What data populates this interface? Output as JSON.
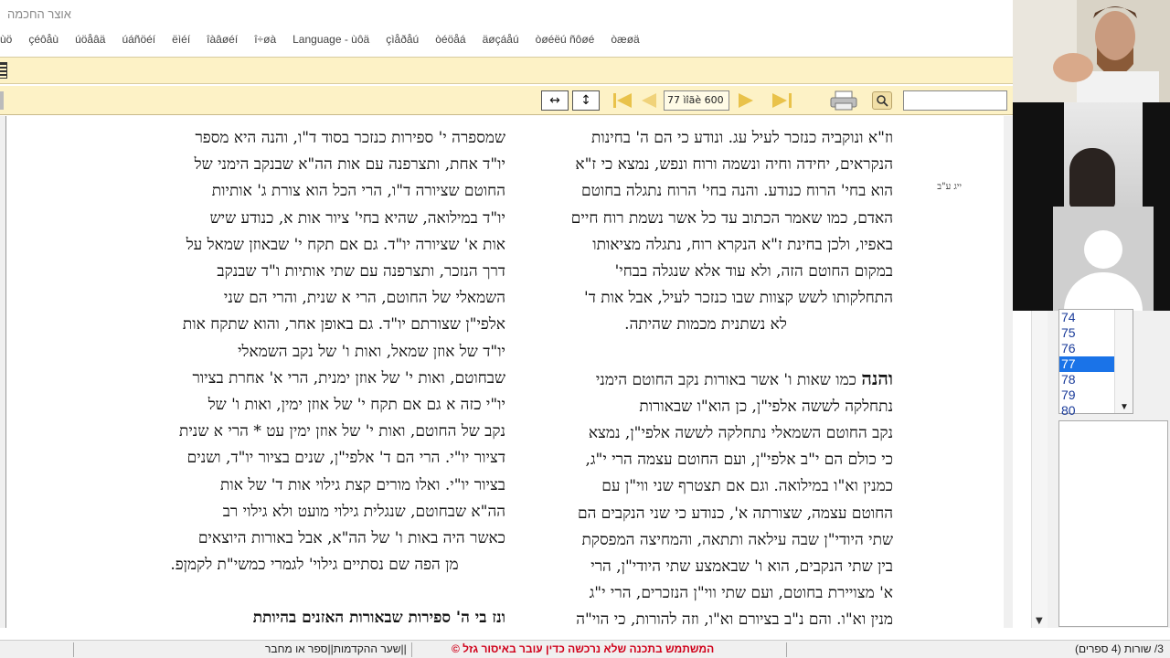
{
  "window": {
    "title": "אוצר החכמה"
  },
  "menu": {
    "items": [
      "ùö",
      "çéôåù",
      "úöåâä",
      "úáñöéí",
      "ëìéí",
      "îàâøéí",
      "î÷øà",
      "Language - ùôä",
      "çìåðåú",
      "òéöåá",
      "äøçáåú",
      "òøéëú ñôøé",
      "òæøä"
    ]
  },
  "toolbar": {
    "page_indicator": "77 ìîãè 600"
  },
  "text": {
    "right_lines": [
      "וז\"א ונוקביה כנזכר לעיל עג. ונודע כי הם ה' בחינות",
      "הנקראים, יחידה וחיה ונשמה ורוח ונפש, נמצא כי ז\"א",
      "הוא בחי' הרוח כנודע. והנה בחי' הרוח נתגלה בחוטם",
      "האדם, כמו שאמר הכתוב עד כל אשר נשמת רוח חיים",
      "באפיו, ולכן בחינת ז\"א הנקרא רוח, נתגלה מציאותו",
      "במקום החוטם הזה, ולא עוד אלא שנגלה בבחי'",
      "התחלקותו לשש קצוות שבו כנזכר לעיל, אבל אות ד'",
      "לא נשתנית מכמות שהיתה."
    ],
    "right_lead": "והנה",
    "right_lines2": [
      "כמו שאות ו' אשר באורות נקב החוטם הימני",
      "נתחלקה לששה אלפי\"ן, כן הוא\"ו שבאורות",
      "נקב החוטם השמאלי נתחלקה לששה אלפי\"ן, נמצא",
      "כי כולם הם י\"ב אלפי\"ן, ועם החוטם עצמה הרי י\"ג,",
      "כמנין וא\"ו במילואה. וגם אם תצטרף שני ווי\"ן עם",
      "החוטם עצמה, שצורתה א', כנודע כי שני הנקבים הם",
      "שתי היודי\"ן שבה עילאה ותתאה, והמחיצה המפסקת",
      "בין שתי הנקבים, הוא ו' שבאמצע שתי היודי\"ן, הרי",
      "א' מצויירת בחוטם, ועם שתי ווי\"ן הנזכרים, הרי י\"ג",
      "מנין וא\"ו. והם נ\"ב בציורם וא\"ו, וזה להורות, כי הוי\"ה"
    ],
    "left_lines": [
      "שמספרה י' ספירות כנזכר בסוד ד\"ו, והנה היא מספר",
      "יו\"ד אחת, ותצרפנה עם אות הה\"א שבנקב הימני של",
      "החוטם שציורה ד\"ו, הרי הכל הוא צורת ג' אותיות",
      "יו\"ד במילואה, שהיא בחי' ציור אות א, כנודע שיש",
      "אות א' שציורה יו\"ד. גם אם תקח י' שבאוזן שמאל על",
      "דרך הנזכר, ותצרפנה עם שתי אותיות ו\"ד שבנקב",
      "השמאלי של החוטם, הרי א שנית, והרי הם שני",
      "אלפי\"ן שצורתם יו\"ד. גם באופן אחר, והוא שתקח אות",
      "יו\"ד של אוזן שמאל, ואות ו' של נקב השמאלי",
      "שבחוטם, ואות י' של אוזן ימנית, הרי א' אחרת בציור",
      "יו\"י כזה א גם אם תקח י' של אוזן ימין, ואות ו' של",
      "נקב של החוטם, ואות י' של אוזן ימין עט * הרי א שנית",
      "דציור יו\"י. הרי הם ד' אלפי\"ן, שנים בציור יו\"ד, ושנים",
      "בציור יו\"י. ואלו מורים קצת גילוי אות ד' של אות",
      "הה\"א שבחוטם, שנגלית גילוי מועט ולא גילוי רב",
      "כאשר היה באות ו' של הה\"א, אבל באורות היוצאים",
      "מן הפה שם נסתיים גילוי' לגמרי כמשי\"ת לקמןפ."
    ],
    "left_lead_tail": "ונז בי ה' ספירות שבאורות האזנים בהיותת",
    "margin_note": "ייג ע\"ב"
  },
  "page_list": {
    "items": [
      "74",
      "75",
      "76",
      "77",
      "78",
      "79",
      "80"
    ],
    "selected": "77"
  },
  "status": {
    "warning": "המשתמש בתכנה שלא נרכשה כדין עובר באיסור גזל  ©",
    "source": "||שער ההקדמות||ספר או מחבר",
    "lines": "3/ שורות (4 ספרים)"
  }
}
